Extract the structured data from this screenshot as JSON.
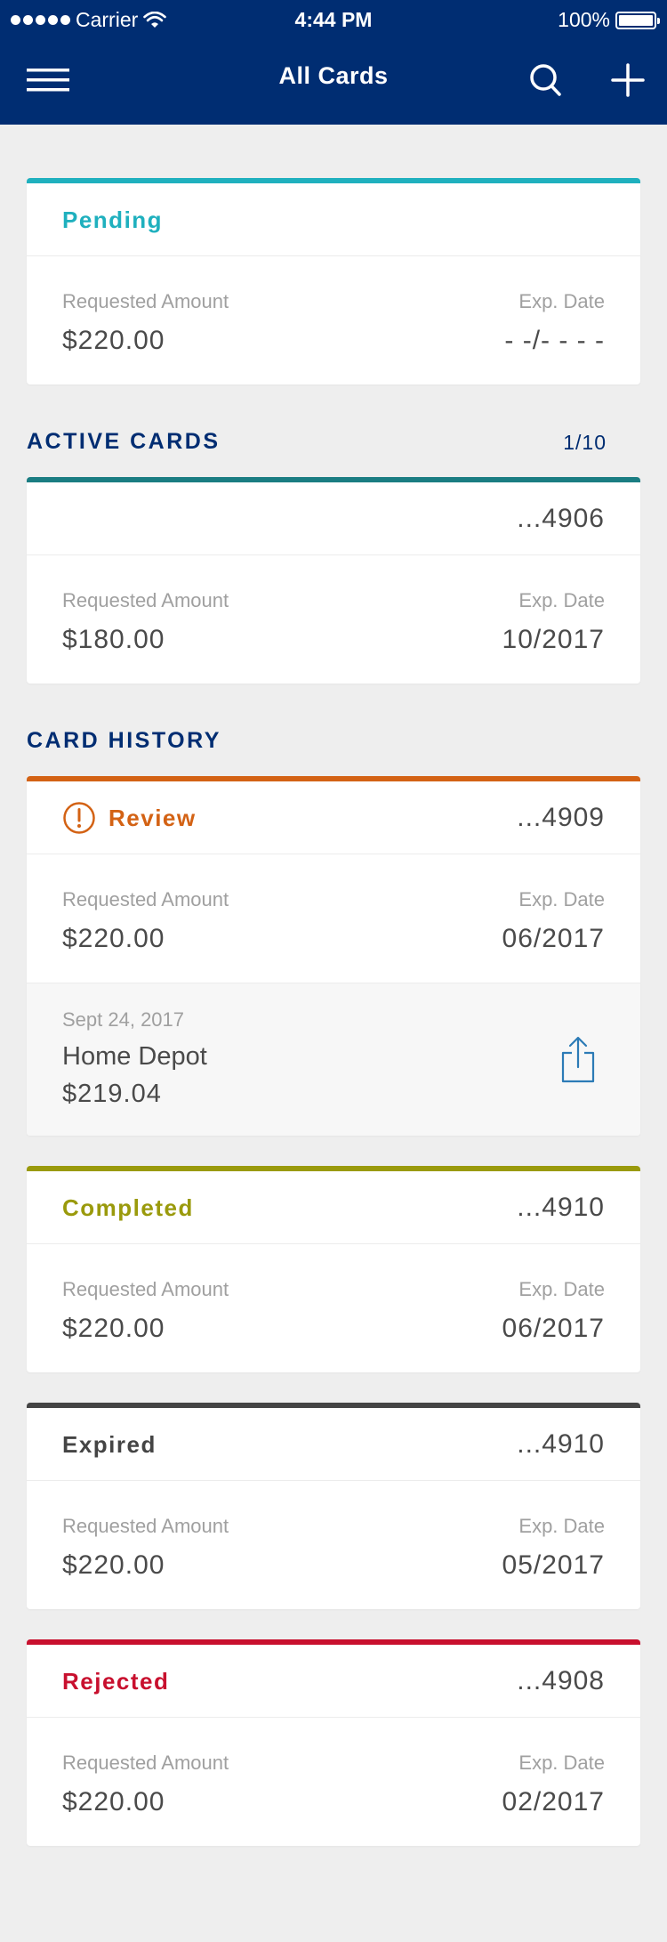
{
  "status_bar": {
    "carrier": "Carrier",
    "time": "4:44 PM",
    "battery": "100%"
  },
  "nav": {
    "title": "All Cards",
    "menu_icon": "hamburger-icon",
    "search_icon": "search-icon",
    "add_icon": "plus-icon"
  },
  "labels": {
    "requested_amount": "Requested Amount",
    "exp_date": "Exp. Date"
  },
  "pending": {
    "status": "Pending",
    "amount": "$220.00",
    "exp": "- -/- - - -",
    "color": "#1fb0be"
  },
  "active_section": {
    "title": "ACTIVE CARDS",
    "count": "1/10"
  },
  "active_card": {
    "number": "...4906",
    "amount": "$180.00",
    "exp": "10/2017",
    "color": "#1a7d82"
  },
  "history_section": {
    "title": "CARD HISTORY"
  },
  "history": [
    {
      "status": "Review",
      "number": "...4909",
      "amount": "$220.00",
      "exp": "06/2017",
      "color": "#d36214",
      "transaction": {
        "date": "Sept 24, 2017",
        "merchant": "Home Depot",
        "amount": "$219.04"
      }
    },
    {
      "status": "Completed",
      "number": "...4910",
      "amount": "$220.00",
      "exp": "06/2017",
      "color": "#9a9a0c"
    },
    {
      "status": "Expired",
      "number": "...4910",
      "amount": "$220.00",
      "exp": "05/2017",
      "color": "#444444"
    },
    {
      "status": "Rejected",
      "number": "...4908",
      "amount": "$220.00",
      "exp": "02/2017",
      "color": "#c8102e"
    }
  ]
}
